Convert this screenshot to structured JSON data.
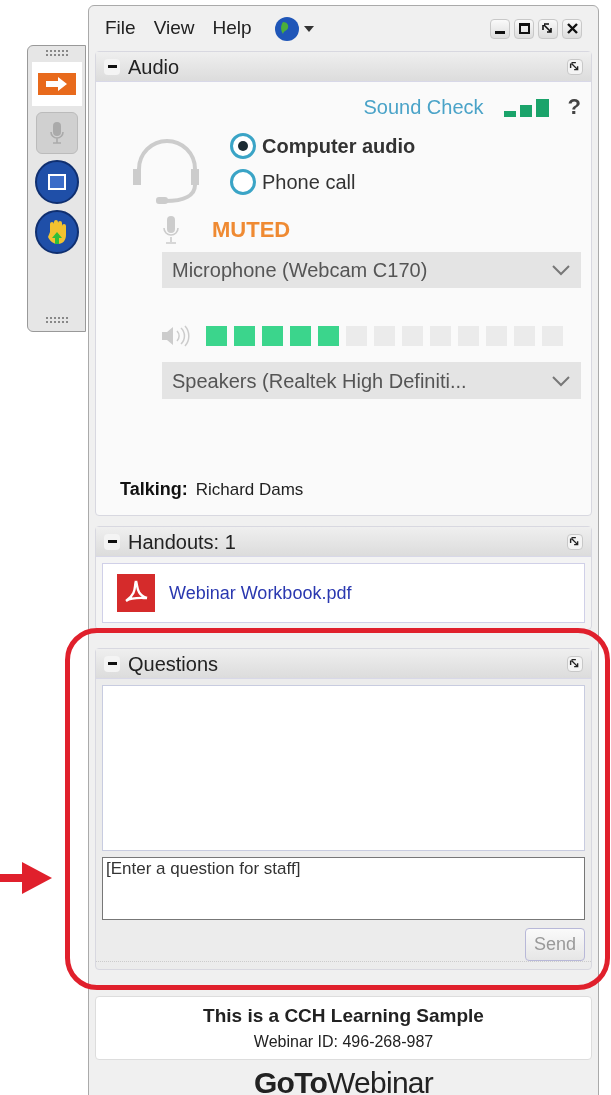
{
  "menu": [
    "File",
    "View",
    "Help"
  ],
  "audio": {
    "title": "Audio",
    "sound_check": "Sound Check",
    "help": "?",
    "options": [
      {
        "label": "Computer audio",
        "selected": true
      },
      {
        "label": "Phone call",
        "selected": false
      }
    ],
    "mic_status": "MUTED",
    "microphone": "Microphone (Webcam C170)",
    "speaker_meter": {
      "level": 0.385
    },
    "speakers": "Speakers (Realtek High Definiti...",
    "talking_label": "Talking:",
    "talking_name": "Richard Dams"
  },
  "handouts": {
    "title": "Handouts: 1",
    "files": [
      "Webinar Workbook.pdf"
    ]
  },
  "questions": {
    "title": "Questions",
    "placeholder": "[Enter a question for staff]",
    "send": "Send"
  },
  "info": {
    "title": "This is a CCH Learning Sample",
    "webinar_id": "Webinar ID: 496-268-987"
  },
  "logo": "**GoTo**Webinar"
}
